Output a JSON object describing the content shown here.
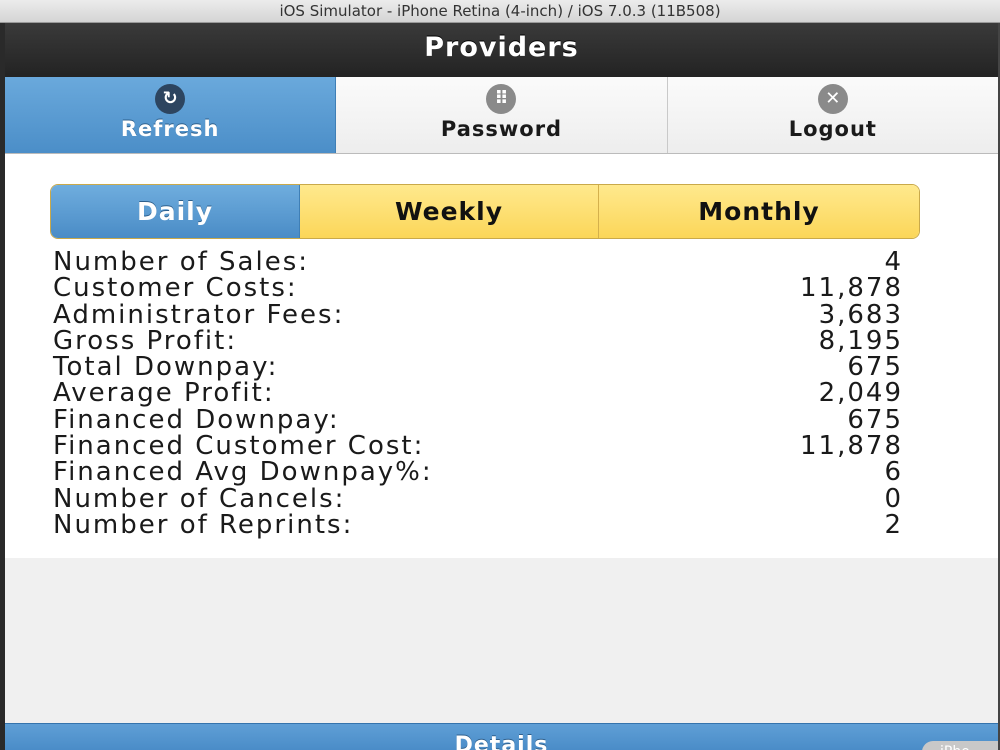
{
  "window": {
    "title": "iOS Simulator - iPhone Retina (4-inch) / iOS 7.0.3 (11B508)"
  },
  "navbar": {
    "title": "Providers"
  },
  "tabs": [
    {
      "label": "Refresh",
      "icon": "refresh-icon",
      "glyph": "↻",
      "active": true
    },
    {
      "label": "Password",
      "icon": "keypad-icon",
      "glyph": "⠿",
      "active": false
    },
    {
      "label": "Logout",
      "icon": "close-icon",
      "glyph": "✕",
      "active": false
    }
  ],
  "segments": [
    {
      "label": "Daily",
      "active": true
    },
    {
      "label": "Weekly",
      "active": false
    },
    {
      "label": "Monthly",
      "active": false
    }
  ],
  "stats": [
    {
      "label": "Number of Sales:",
      "value": "4"
    },
    {
      "label": "Customer Costs:",
      "value": "11,878"
    },
    {
      "label": "Administrator Fees:",
      "value": "3,683"
    },
    {
      "label": "Gross Profit:",
      "value": "8,195"
    },
    {
      "label": "Total Downpay:",
      "value": "675"
    },
    {
      "label": "Average Profit:",
      "value": "2,049"
    },
    {
      "label": "Financed Downpay:",
      "value": "675"
    },
    {
      "label": "Financed Customer Cost:",
      "value": "11,878"
    },
    {
      "label": "Financed Avg Downpay%:",
      "value": "6"
    },
    {
      "label": "Number of Cancels:",
      "value": "0"
    },
    {
      "label": "Number of Reprints:",
      "value": "2"
    }
  ],
  "footer": {
    "button_label": "Details"
  },
  "device_badge": {
    "text": "iPho"
  },
  "colors": {
    "accent_blue": "#4b8ec8",
    "segment_yellow": "#fbd659",
    "navbar_dark": "#232323"
  }
}
